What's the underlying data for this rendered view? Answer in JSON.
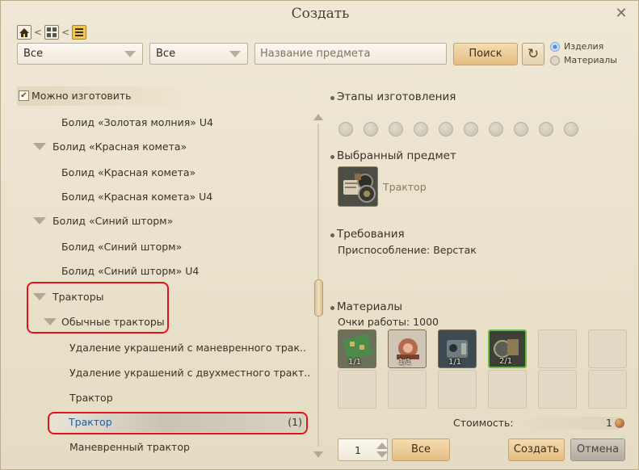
{
  "window": {
    "title": "Создать",
    "close_symbol": "✕"
  },
  "breadcrumb": {
    "separator": "<"
  },
  "filters": {
    "select1_value": "Все",
    "select2_value": "Все",
    "search_placeholder": "Название предмета",
    "search_button": "Поиск",
    "radio_options": [
      {
        "label": "Изделия",
        "selected": true
      },
      {
        "label": "Материалы",
        "selected": false
      }
    ]
  },
  "tree": {
    "group_label": "Можно изготовить",
    "rows": [
      {
        "label": "Болид «Золотая молния» U4",
        "level": 2,
        "expanded": false
      },
      {
        "label": "Болид «Красная комета»",
        "level": 1,
        "expanded": true
      },
      {
        "label": "Болид «Красная комета»",
        "level": 2,
        "expanded": false
      },
      {
        "label": "Болид «Красная комета» U4",
        "level": 2,
        "expanded": false
      },
      {
        "label": "Болид «Синий шторм»",
        "level": 1,
        "expanded": true
      },
      {
        "label": "Болид «Синий шторм»",
        "level": 2,
        "expanded": false
      },
      {
        "label": "Болид «Синий шторм» U4",
        "level": 2,
        "expanded": false
      },
      {
        "label": "Тракторы",
        "level": 1,
        "expanded": true
      },
      {
        "label": "Обычные тракторы",
        "level": 2,
        "expanded": true
      },
      {
        "label": "Удаление украшений с маневренного трак..",
        "level": 3,
        "expanded": false
      },
      {
        "label": "Удаление украшений с двухместного тракт..",
        "level": 3,
        "expanded": false
      },
      {
        "label": "Трактор",
        "level": 3,
        "expanded": false
      },
      {
        "label": "Маневренный трактор",
        "level": 3,
        "expanded": false
      }
    ],
    "selected": {
      "label": "Трактор",
      "count": "(1)"
    }
  },
  "details": {
    "stages_title": "Этапы изготовления",
    "stage_count": 10,
    "selected_title": "Выбранный предмет",
    "selected_item_name": "Трактор",
    "requirements_title": "Требования",
    "requirements_text": "Приспособление: Верстак",
    "materials_title": "Материалы",
    "work_points": "Очки работы: 1000",
    "materials": [
      {
        "icon": "circuit-board-icon",
        "count": "1/1",
        "ready": false
      },
      {
        "icon": "copper-coil-icon",
        "count": "1/1",
        "ready": false
      },
      {
        "icon": "engine-part-icon",
        "count": "1/1",
        "ready": false
      },
      {
        "icon": "tractor-parts-icon",
        "count": "2/1",
        "ready": true
      }
    ],
    "cost_label": "Стоимость:",
    "cost_value": "1"
  },
  "footer": {
    "quantity": "1",
    "all_button": "Все",
    "create_button": "Создать",
    "cancel_button": "Отмена"
  },
  "colors": {
    "accent_selected_text": "#235d9a",
    "highlight_box": "#e3131b",
    "ready_border": "#6bbd3f"
  }
}
